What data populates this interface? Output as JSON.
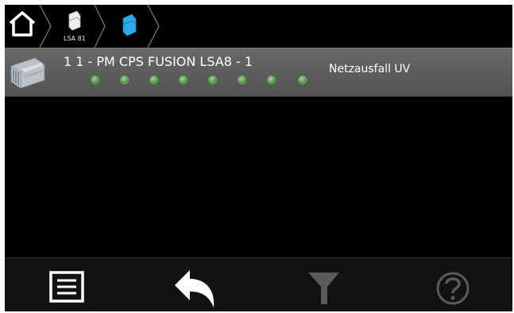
{
  "breadcrumb": {
    "items": [
      {
        "icon": "home-icon",
        "label": ""
      },
      {
        "icon": "module-icon",
        "label": "LSA 81"
      },
      {
        "icon": "module-selected-icon",
        "label": ""
      }
    ]
  },
  "device": {
    "icon": "device-module-icon",
    "title": "1 1 - PM CPS FUSION LSA8 - 1",
    "status": "Netzausfall UV",
    "led_color": "#5f9b55",
    "led_count": 8
  },
  "toolbar": {
    "buttons": [
      {
        "icon": "list-icon",
        "enabled": true
      },
      {
        "icon": "back-arrow-icon",
        "enabled": true
      },
      {
        "icon": "filter-icon",
        "enabled": false
      },
      {
        "icon": "help-icon",
        "enabled": false
      }
    ]
  },
  "colors": {
    "background": "#000000",
    "row": "#5d5d5d",
    "accent_blue": "#2fa9e8",
    "disabled": "#5a5a5a"
  }
}
